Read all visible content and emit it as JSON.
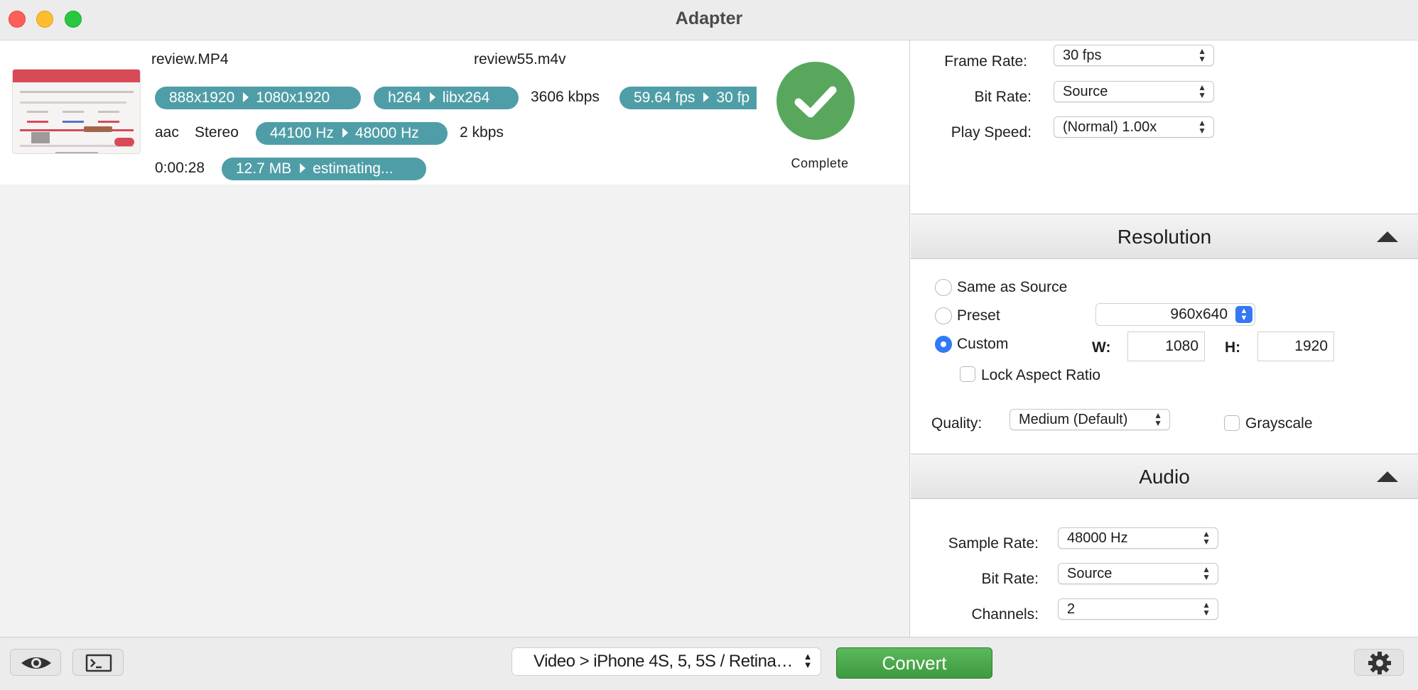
{
  "window": {
    "title": "Adapter"
  },
  "job": {
    "source_name": "review.MP4",
    "output_name": "review55.m4v",
    "resolution": {
      "from": "888x1920",
      "to": "1080x1920"
    },
    "codec": {
      "from": "h264",
      "to": "libx264"
    },
    "video_bitrate": "3606 kbps",
    "fps": {
      "from": "59.64 fps",
      "to": "30 fp"
    },
    "audio_codec": "aac",
    "audio_channels": "Stereo",
    "sample_rate": {
      "from": "44100 Hz",
      "to": "48000 Hz"
    },
    "audio_bitrate": "2 kbps",
    "duration": "0:00:28",
    "size": {
      "from": "12.7 MB",
      "to": "estimating..."
    },
    "status": "Complete"
  },
  "video_settings": {
    "frame_rate_label": "Frame Rate:",
    "frame_rate_value": "30 fps",
    "bit_rate_label": "Bit Rate:",
    "bit_rate_value": "Source",
    "play_speed_label": "Play Speed:",
    "play_speed_value": "(Normal) 1.00x"
  },
  "resolution": {
    "title": "Resolution",
    "same_as_source": "Same as Source",
    "preset_label": "Preset",
    "preset_value": "960x640",
    "custom_label": "Custom",
    "w_label": "W:",
    "width": "1080",
    "h_label": "H:",
    "height": "1920",
    "lock_aspect": "Lock Aspect Ratio",
    "quality_label": "Quality:",
    "quality_value": "Medium (Default)",
    "grayscale": "Grayscale",
    "selected": "custom"
  },
  "audio": {
    "title": "Audio",
    "sample_rate_label": "Sample Rate:",
    "sample_rate_value": "48000 Hz",
    "bit_rate_label": "Bit Rate:",
    "bit_rate_value": "Source",
    "channels_label": "Channels:",
    "channels_value": "2"
  },
  "toolbar": {
    "preset": "Video > iPhone 4S, 5, 5S / Retina…",
    "convert": "Convert"
  },
  "colors": {
    "pill": "#4f9ea7",
    "complete": "#58a75d",
    "convert": "#4aa84a",
    "accent": "#2f7bf5"
  }
}
